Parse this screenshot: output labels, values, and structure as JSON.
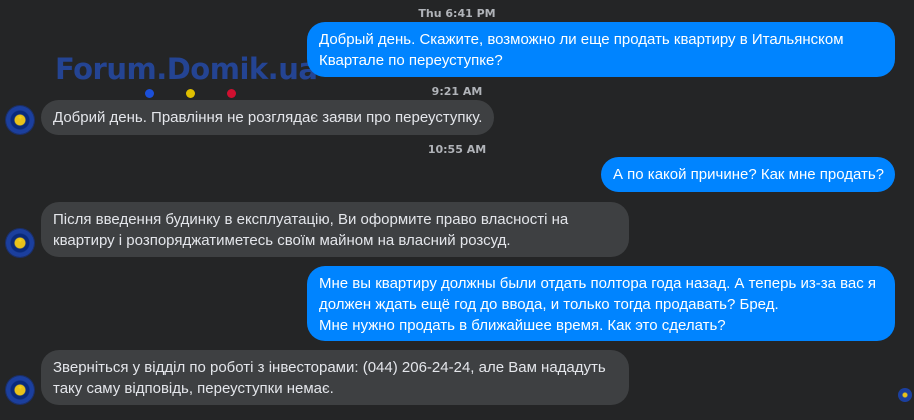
{
  "watermark": "Forum.Domik.ua",
  "colors": {
    "background": "#242526",
    "outgoing_bubble": "#0084ff",
    "incoming_bubble": "#3e4042",
    "timestamp": "#b0b3b8",
    "watermark_dots": [
      "#1b4fd8",
      "#e0c000",
      "#d01030"
    ]
  },
  "timestamps": [
    "Thu 6:41 PM",
    "9:21 AM",
    "10:55 AM"
  ],
  "messages": [
    {
      "direction": "outgoing",
      "lines": [
        "Добрый день. Скажите, возможно ли еще продать квартиру в Итальянском",
        "Квартале по переуступке?"
      ]
    },
    {
      "direction": "incoming",
      "lines": [
        "Добрий день. Правління не розглядає заяви про переуступку."
      ]
    },
    {
      "direction": "outgoing",
      "lines": [
        "А по какой причине? Как мне продать?"
      ]
    },
    {
      "direction": "incoming",
      "lines": [
        "Після введення будинку в експлуатацію, Ви оформите право власності на",
        "квартиру і розпоряджатиметесь своїм майном на власний розсуд."
      ]
    },
    {
      "direction": "outgoing",
      "lines": [
        "Мне вы квартиру должны были отдать полтора года назад. А теперь из-за вас я",
        "должен ждать ещё год до ввода, и только тогда продавать? Бред.",
        "Мне нужно продать в ближайшее время. Как это сделать?"
      ]
    },
    {
      "direction": "incoming",
      "lines": [
        "Зверніться у відділ по роботі з інвесторами: (044) 206-24-24, але Вам нададуть",
        "таку саму відповідь, переуступки немає."
      ]
    }
  ]
}
